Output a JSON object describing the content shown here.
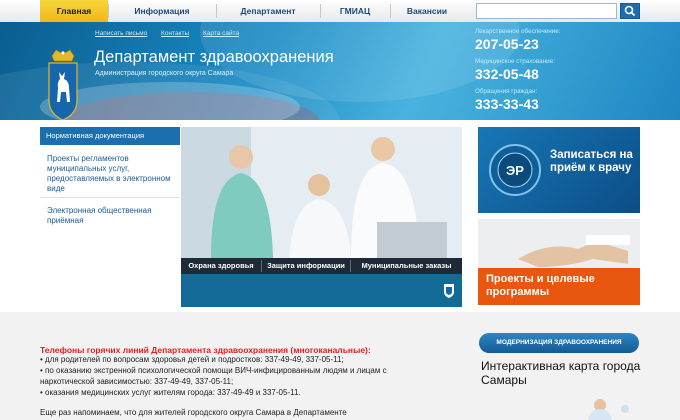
{
  "nav": {
    "items": [
      "Главная",
      "Информация",
      "Департамент",
      "ГМИАЦ",
      "Вакансии"
    ],
    "search_placeholder": ""
  },
  "header": {
    "links": [
      "Написать письмо",
      "Контакты",
      "Карта сайта"
    ],
    "title": "Департамент здравоохранения",
    "subtitle": "Администрация городского округа Самара",
    "contacts": [
      {
        "label": "Лекарственное обеспечение:",
        "phone": "207-05-23"
      },
      {
        "label": "Медицинское страхование:",
        "phone": "332-05-48"
      },
      {
        "label": "Обращения граждан:",
        "phone": "333-33-43"
      }
    ]
  },
  "sidebar": {
    "header": "Нормативная документация",
    "items": [
      "Проекты регламентов муниципальных услуг, предоставляемых в электронном виде",
      "Электронная общественная приёмная"
    ]
  },
  "slider": {
    "tabs": [
      "Охрана здоровья",
      "Защита информации",
      "Муниципальные заказы"
    ]
  },
  "banners": {
    "appointment": "Записаться на приём к врачу",
    "appointment_logo": "ЭР",
    "programs": "Проекты и целевые программы"
  },
  "hotlines": {
    "title": "Телефоны горячих линий Департамента здравоохранения (многоканальные):",
    "lines": [
      "• для родителей по вопросам здоровья детей и подростков: 337-49-49, 337-05-11;",
      "• по оказанию экстренной психологической помощи ВИЧ-инфицированным людям и лицам с",
      "наркотической зависимостью: 337-49-49, 337-05-11;",
      "• оказания медицинских услуг жителям города: 337-49-49 и 337-05-11."
    ],
    "note": "Еще раз напоминаем, что для жителей городского округа Самара в Департаменте"
  },
  "right_lower": {
    "modernization": "МОДЕРНИЗАЦИЯ ЗДРАВООХРАНЕНИЯ",
    "map_title": "Интерактивная карта города Самары"
  },
  "colors": {
    "accent_blue": "#1c6fae",
    "nav_active": "#f0c22a",
    "hotline_red": "#e02020",
    "programs_orange": "#e8560f"
  }
}
